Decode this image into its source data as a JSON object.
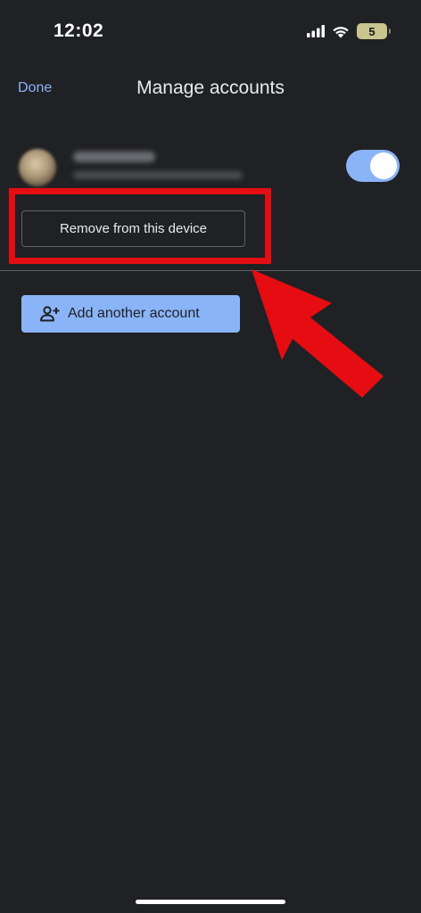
{
  "status_bar": {
    "time": "12:02",
    "battery_level": "5",
    "icons": [
      "signal-icon",
      "wifi-icon",
      "battery-icon"
    ]
  },
  "header": {
    "done_label": "Done",
    "title": "Manage accounts"
  },
  "account": {
    "toggle_on": true,
    "name_redacted": true,
    "email_redacted": true
  },
  "actions": {
    "remove_label": "Remove from this device",
    "add_account_label": "Add another account",
    "add_account_icon": "person-add-icon"
  },
  "colors": {
    "background": "#202124",
    "accent": "#8ab4f8",
    "annotation_red": "#e50d12"
  }
}
